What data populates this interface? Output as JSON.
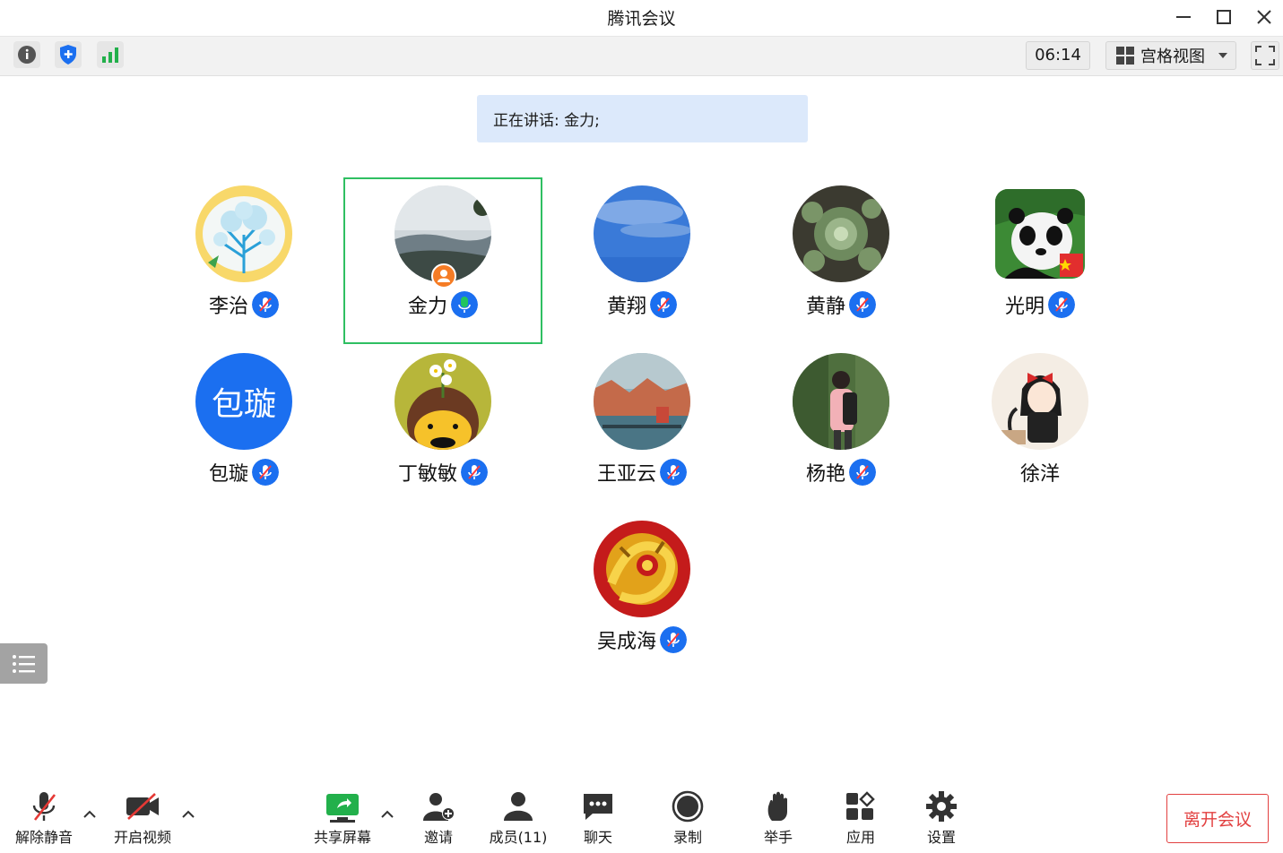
{
  "window": {
    "title": "腾讯会议"
  },
  "toolbar": {
    "timer": "06:14",
    "view_label": "宫格视图"
  },
  "speaking": {
    "text": "正在讲话: 金力;"
  },
  "participants": [
    {
      "name": "李治",
      "mic": "muted"
    },
    {
      "name": "金力",
      "mic": "on",
      "host": true,
      "active": true
    },
    {
      "name": "黄翔",
      "mic": "muted"
    },
    {
      "name": "黄静",
      "mic": "muted"
    },
    {
      "name": "光明",
      "mic": "muted"
    },
    {
      "name": "包璇",
      "mic": "muted",
      "avatar_text": "包璇"
    },
    {
      "name": "丁敏敏",
      "mic": "muted"
    },
    {
      "name": "王亚云",
      "mic": "muted"
    },
    {
      "name": "杨艳",
      "mic": "muted"
    },
    {
      "name": "徐洋",
      "mic": "none"
    },
    {
      "name": "吴成海",
      "mic": "muted"
    }
  ],
  "bottom": {
    "unmute": "解除静音",
    "video": "开启视频",
    "share": "共享屏幕",
    "invite": "邀请",
    "members": "成员(11)",
    "chat": "聊天",
    "record": "录制",
    "raise_hand": "举手",
    "apps": "应用",
    "settings": "设置",
    "leave": "离开会议"
  },
  "colors": {
    "accent": "#1b6ff0",
    "active_border": "#2fbf62",
    "leave": "#e24040",
    "banner": "#dce9fb"
  }
}
